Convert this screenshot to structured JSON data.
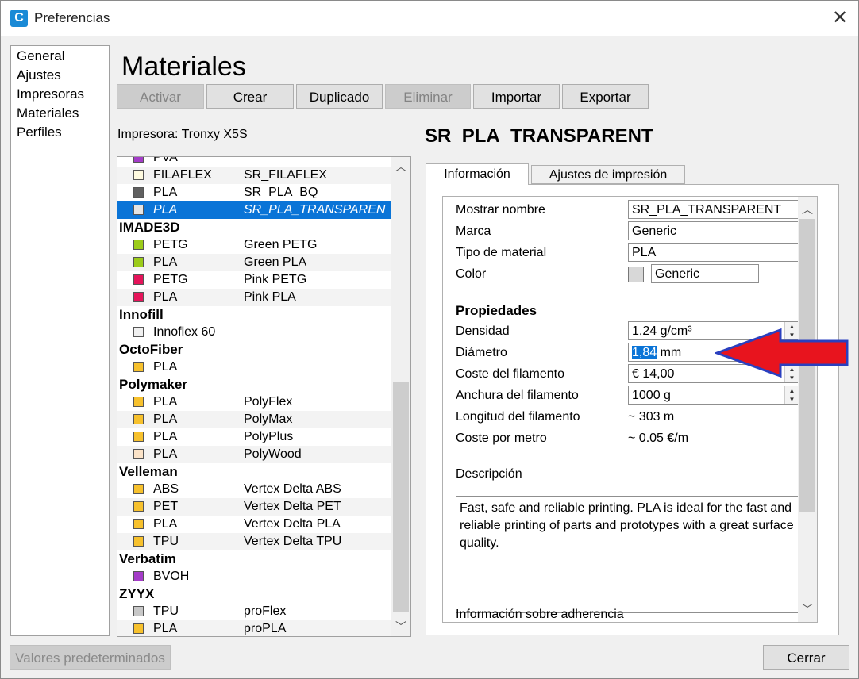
{
  "window": {
    "title": "Preferencias",
    "app_icon": "C",
    "close_glyph": "✕"
  },
  "nav": {
    "items": [
      "General",
      "Ajustes",
      "Impresoras",
      "Materiales",
      "Perfiles"
    ]
  },
  "page_title": "Materiales",
  "toolbar": {
    "activate": "Activar",
    "create": "Crear",
    "duplicate": "Duplicado",
    "remove": "Eliminar",
    "import": "Importar",
    "export": "Exportar"
  },
  "printer_label": "Impresora: Tronxy X5S",
  "materials": [
    {
      "kind": "item",
      "type": "PVA",
      "name": "",
      "color": "#a43cc8"
    },
    {
      "kind": "item",
      "type": "FILAFLEX",
      "name": "SR_FILAFLEX",
      "color": "#fffbe0"
    },
    {
      "kind": "item",
      "type": "PLA",
      "name": "SR_PLA_BQ",
      "color": "#606060"
    },
    {
      "kind": "item",
      "type": "PLA",
      "name": "SR_PLA_TRANSPAREN",
      "color": "#e4e4e4",
      "selected": true
    },
    {
      "kind": "brand",
      "name": "IMADE3D"
    },
    {
      "kind": "item",
      "type": "PETG",
      "name": "Green PETG",
      "color": "#9ccc1a"
    },
    {
      "kind": "item",
      "type": "PLA",
      "name": "Green PLA",
      "color": "#9ccc1a"
    },
    {
      "kind": "item",
      "type": "PETG",
      "name": "Pink PETG",
      "color": "#e5145a"
    },
    {
      "kind": "item",
      "type": "PLA",
      "name": "Pink PLA",
      "color": "#e5145a"
    },
    {
      "kind": "brand",
      "name": "Innofill"
    },
    {
      "kind": "item",
      "type": "Innoflex 60",
      "name": "",
      "color": "#f0f0f0"
    },
    {
      "kind": "brand",
      "name": "OctoFiber"
    },
    {
      "kind": "item",
      "type": "PLA",
      "name": "",
      "color": "#f7c12d"
    },
    {
      "kind": "brand",
      "name": "Polymaker"
    },
    {
      "kind": "item",
      "type": "PLA",
      "name": "PolyFlex",
      "color": "#f7c12d"
    },
    {
      "kind": "item",
      "type": "PLA",
      "name": "PolyMax",
      "color": "#f7c12d"
    },
    {
      "kind": "item",
      "type": "PLA",
      "name": "PolyPlus",
      "color": "#f7c12d"
    },
    {
      "kind": "item",
      "type": "PLA",
      "name": "PolyWood",
      "color": "#fbe3c8"
    },
    {
      "kind": "brand",
      "name": "Velleman"
    },
    {
      "kind": "item",
      "type": "ABS",
      "name": "Vertex Delta ABS",
      "color": "#f7c12d"
    },
    {
      "kind": "item",
      "type": "PET",
      "name": "Vertex Delta PET",
      "color": "#f7c12d"
    },
    {
      "kind": "item",
      "type": "PLA",
      "name": "Vertex Delta PLA",
      "color": "#f7c12d"
    },
    {
      "kind": "item",
      "type": "TPU",
      "name": "Vertex Delta TPU",
      "color": "#f7c12d"
    },
    {
      "kind": "brand",
      "name": "Verbatim"
    },
    {
      "kind": "item",
      "type": "BVOH",
      "name": "",
      "color": "#a43cc8"
    },
    {
      "kind": "brand",
      "name": "ZYYX"
    },
    {
      "kind": "item",
      "type": "TPU",
      "name": "proFlex",
      "color": "#c8c8c8"
    },
    {
      "kind": "item",
      "type": "PLA",
      "name": "proPLA",
      "color": "#f7c12d"
    }
  ],
  "material_title": "SR_PLA_TRANSPARENT",
  "tabs": {
    "info": "Información",
    "print_settings": "Ajustes de impresión"
  },
  "info": {
    "display_name_label": "Mostrar nombre",
    "display_name_value": "SR_PLA_TRANSPARENT",
    "brand_label": "Marca",
    "brand_value": "Generic",
    "material_type_label": "Tipo de material",
    "material_type_value": "PLA",
    "color_label": "Color",
    "color_value": "Generic",
    "color_swatch": "#d8d8d8",
    "properties_heading": "Propiedades",
    "density_label": "Densidad",
    "density_value": "1,24 g/cm³",
    "diameter_label": "Diámetro",
    "diameter_value": "1,84",
    "diameter_unit": " mm",
    "filament_cost_label": "Coste del filamento",
    "filament_cost_value": "€ 14,00",
    "filament_weight_label": "Anchura del filamento",
    "filament_weight_value": "1000 g",
    "filament_length_label": "Longitud del filamento",
    "filament_length_value": "~ 303 m",
    "cost_per_meter_label": "Coste por metro",
    "cost_per_meter_value": "~ 0.05 €/m",
    "description_label": "Descripción",
    "description_text": "Fast, safe and reliable printing. PLA is ideal for the fast and reliable printing of parts and prototypes with a great surface quality.",
    "adhesion_label": "Información sobre adherencia"
  },
  "footer": {
    "defaults": "Valores predeterminados",
    "close": "Cerrar"
  },
  "colors": {
    "selection": "#0a74d7",
    "arrow": "#e8141e",
    "arrow_outline": "#2a3fbf"
  }
}
